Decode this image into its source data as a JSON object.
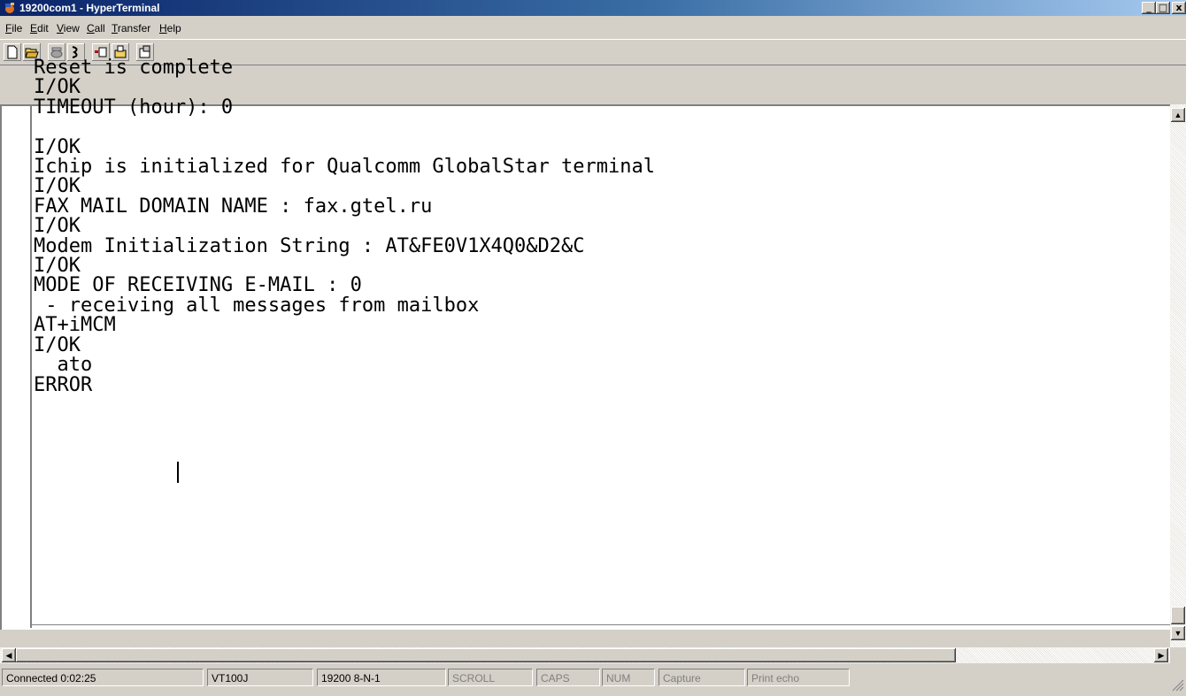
{
  "window": {
    "title": "19200com1 - HyperTerminal",
    "controls": {
      "minimize": "_",
      "maximize": "□",
      "close": "x"
    }
  },
  "menu": {
    "items": [
      {
        "label": "File",
        "accel": "F",
        "rest": "ile"
      },
      {
        "label": "Edit",
        "accel": "E",
        "rest": "dit"
      },
      {
        "label": "View",
        "accel": "V",
        "rest": "iew"
      },
      {
        "label": "Call",
        "accel": "C",
        "rest": "all"
      },
      {
        "label": "Transfer",
        "accel": "T",
        "rest": "ransfer"
      },
      {
        "label": "Help",
        "accel": "H",
        "rest": "elp"
      }
    ]
  },
  "toolbar": {
    "buttons": [
      {
        "icon": "new-document-icon"
      },
      {
        "icon": "open-folder-icon"
      },
      {
        "icon": "disconnect-phone-icon"
      },
      {
        "icon": "dial-icon"
      },
      {
        "icon": "send-icon"
      },
      {
        "icon": "receive-icon"
      },
      {
        "icon": "properties-icon"
      }
    ]
  },
  "terminal": {
    "lines": [
      "Reset is complete",
      "I/OK",
      "TIMEOUT (hour): 0",
      "",
      "I/OK",
      "Ichip is initialized for Qualcomm GlobalStar terminal",
      "I/OK",
      "FAX MAIL DOMAIN NAME : fax.gtel.ru",
      "I/OK",
      "Modem Initialization String : AT&FE0V1X4Q0&D2&C",
      "I/OK",
      "MODE OF RECEIVING E-MAIL : 0",
      " - receiving all messages from mailbox",
      "AT+iMCM",
      "I/OK",
      "  ato",
      "ERROR"
    ]
  },
  "statusbar": {
    "connected": "Connected 0:02:25",
    "emulation": "VT100J",
    "settings": "19200 8-N-1",
    "scroll": "SCROLL",
    "caps": "CAPS",
    "num": "NUM",
    "capture": "Capture",
    "print_echo": "Print echo"
  }
}
